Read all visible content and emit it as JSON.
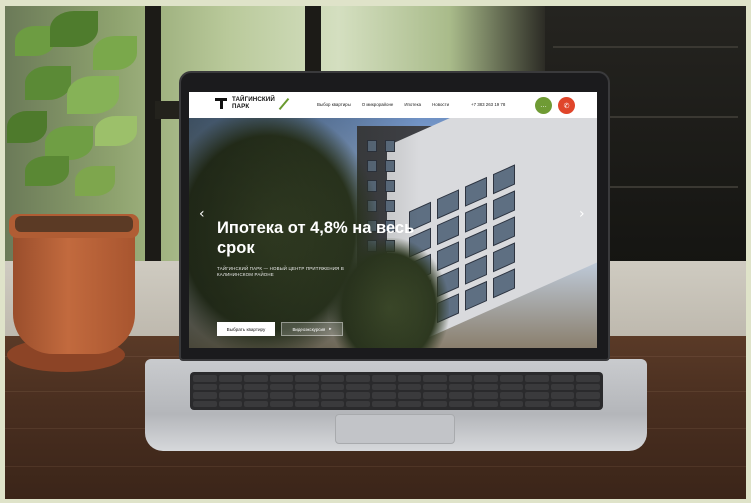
{
  "site": {
    "logo": {
      "line1": "ТАЙГИНСКИЙ",
      "line2": "ПАРК"
    },
    "nav": [
      {
        "label": "Выбор квартиры"
      },
      {
        "label": "О микрорайоне"
      },
      {
        "label": "Ипотека"
      },
      {
        "label": "Новости"
      }
    ],
    "phone": "+7 383 263 19 78",
    "hero": {
      "title": "Ипотека от 4,8% на весь срок",
      "subtitle": "ТАЙГИНСКИЙ ПАРК — НОВЫЙ ЦЕНТР ПРИТЯЖЕНИЯ В КАЛИНИНСКОМ РАЙОНЕ",
      "primary_button": "Выбрать квартиру",
      "secondary_button": "Видеоэкскурсия",
      "prev_arrow": "‹",
      "next_arrow": "›"
    },
    "icons": {
      "green_button": "chat-icon",
      "red_button": "phone-icon"
    },
    "colors": {
      "accent_green": "#6f9b34",
      "accent_red": "#e0452a"
    }
  }
}
